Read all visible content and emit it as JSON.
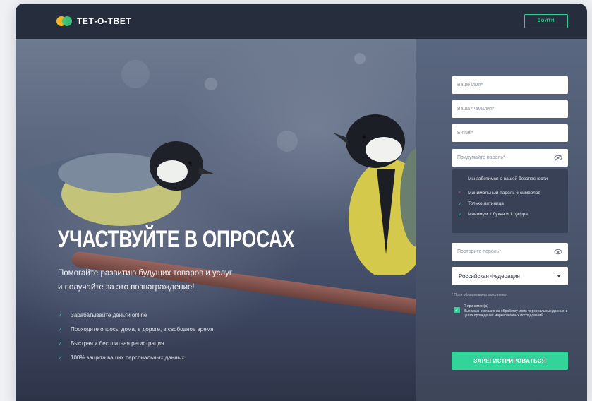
{
  "header": {
    "logo_text": "ТЕТ-О-ТВЕТ",
    "login_label": "ВОЙТИ"
  },
  "hero": {
    "title": "УЧАСТВУЙТЕ В ОПРОСАХ",
    "subtitle_line1": "Помогайте развитию будущих товаров и услуг",
    "subtitle_line2": "и получайте за это вознаграждение!",
    "features": [
      "Зарабатывайте деньги online",
      "Проходите опросы дома, в дороге, в свободное время",
      "Быстрая и бесплатная регистрация",
      "100% защита ваших персональных данных"
    ]
  },
  "form": {
    "first_name_placeholder": "Ваше Имя*",
    "last_name_placeholder": "Ваша Фамилия*",
    "email_placeholder": "E-mail*",
    "password_placeholder": "Придумайте пароль*",
    "password_hint": {
      "title": "Мы заботимся о вашей безопасности",
      "items": [
        {
          "text": "Минимальный пароль 6 символов",
          "mark": "×",
          "color": "#e0566a"
        },
        {
          "text": "Только латиница",
          "mark": "✓",
          "color": "#2fcf93"
        },
        {
          "text": "Минимум 1 буква и 1 цифра",
          "mark": "✓",
          "color": "#2fcf93"
        }
      ]
    },
    "repeat_password_placeholder": "Повторите пароль*",
    "country_value": "Российская Федерация",
    "required_note": "* Поля обязательного заполнения",
    "agree_prefix": "Я принимаю(а)",
    "agree_text": "Выражаю согласие на обработку моих персональных данных в целях проведения маркетинговых исследований.",
    "submit_label": "ЗАРЕГИСТРИРОВАТЬСЯ"
  },
  "colors": {
    "accent": "#2fcf93",
    "header_bg": "#262d3d",
    "error": "#e0566a"
  }
}
